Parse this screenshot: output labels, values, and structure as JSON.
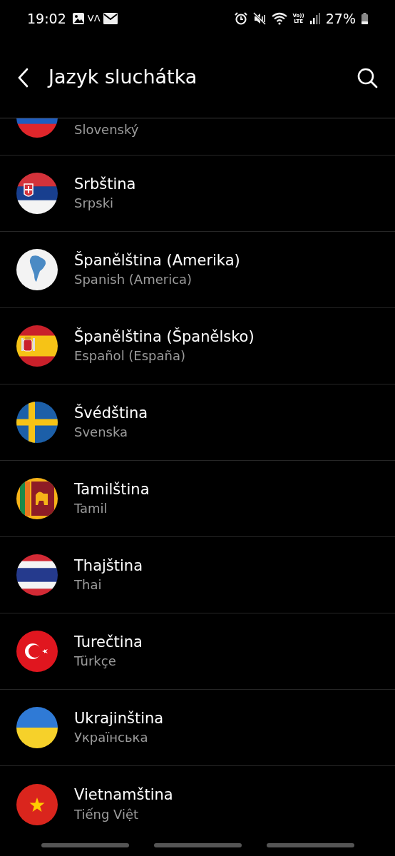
{
  "status_bar": {
    "time": "19:02",
    "carrier_mark": "VΛ",
    "volte_top": "Vo))",
    "volte_bottom": "LTE",
    "battery": "27%"
  },
  "header": {
    "title": "Jazyk sluchátka"
  },
  "languages": [
    {
      "subtitle": "Slovenský"
    },
    {
      "title": "Srbština",
      "subtitle": "Srpski"
    },
    {
      "title": "Španělština (Amerika)",
      "subtitle": "Spanish (America)"
    },
    {
      "title": "Španělština (Španělsko)",
      "subtitle": "Español (España)"
    },
    {
      "title": "Švédština",
      "subtitle": "Svenska"
    },
    {
      "title": "Tamilština",
      "subtitle": "Tamil"
    },
    {
      "title": "Thajština",
      "subtitle": "Thai"
    },
    {
      "title": "Turečtina",
      "subtitle": "Türkçe"
    },
    {
      "title": "Ukrajinština",
      "subtitle": "Українська"
    },
    {
      "title": "Vietnamština",
      "subtitle": "Tiếng Việt"
    }
  ]
}
